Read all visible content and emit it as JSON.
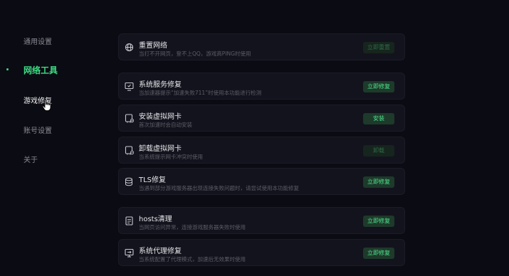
{
  "sidebar": {
    "items": [
      {
        "label": "通用设置"
      },
      {
        "label": "网络工具"
      },
      {
        "label": "游戏修复"
      },
      {
        "label": "账号设置"
      },
      {
        "label": "关于"
      }
    ],
    "active_index": 1
  },
  "cards": [
    {
      "title": "重置网络",
      "desc": "当打不开网页，登不上QQ，游戏高PING时使用",
      "button": "立即重置",
      "button_enabled": false,
      "icon": "globe-icon"
    },
    {
      "title": "系统服务修复",
      "desc": "当加速器提示“加速失败711”时使用本功能进行检测",
      "button": "立即修复",
      "button_enabled": true,
      "icon": "service-monitor-icon"
    },
    {
      "title": "安装虚拟网卡",
      "desc": "首次加速时会自动安装",
      "button": "安装",
      "button_enabled": true,
      "icon": "network-card-add-icon"
    },
    {
      "title": "卸载虚拟网卡",
      "desc": "当系统提示网卡冲突时使用",
      "button": "卸载",
      "button_enabled": false,
      "icon": "network-card-remove-icon"
    },
    {
      "title": "TLS修复",
      "desc": "当遇到部分游戏服务器出现连接失败问题时，请尝试使用本功能修复",
      "button": "立即修复",
      "button_enabled": true,
      "icon": "tls-database-icon"
    },
    {
      "title": "hosts清理",
      "desc": "当网页访问异常，连接游戏服务器失败时使用",
      "button": "立即修复",
      "button_enabled": true,
      "icon": "hosts-file-icon"
    },
    {
      "title": "系统代理修复",
      "desc": "当系统配置了代理模式，加速后无效果时使用",
      "button": "立即修复",
      "button_enabled": true,
      "icon": "proxy-monitor-icon"
    }
  ],
  "colors": {
    "accent": "#3ddc84",
    "background": "#0b0b13",
    "card": "#13131d",
    "button_bg": "#1d3a2a"
  }
}
